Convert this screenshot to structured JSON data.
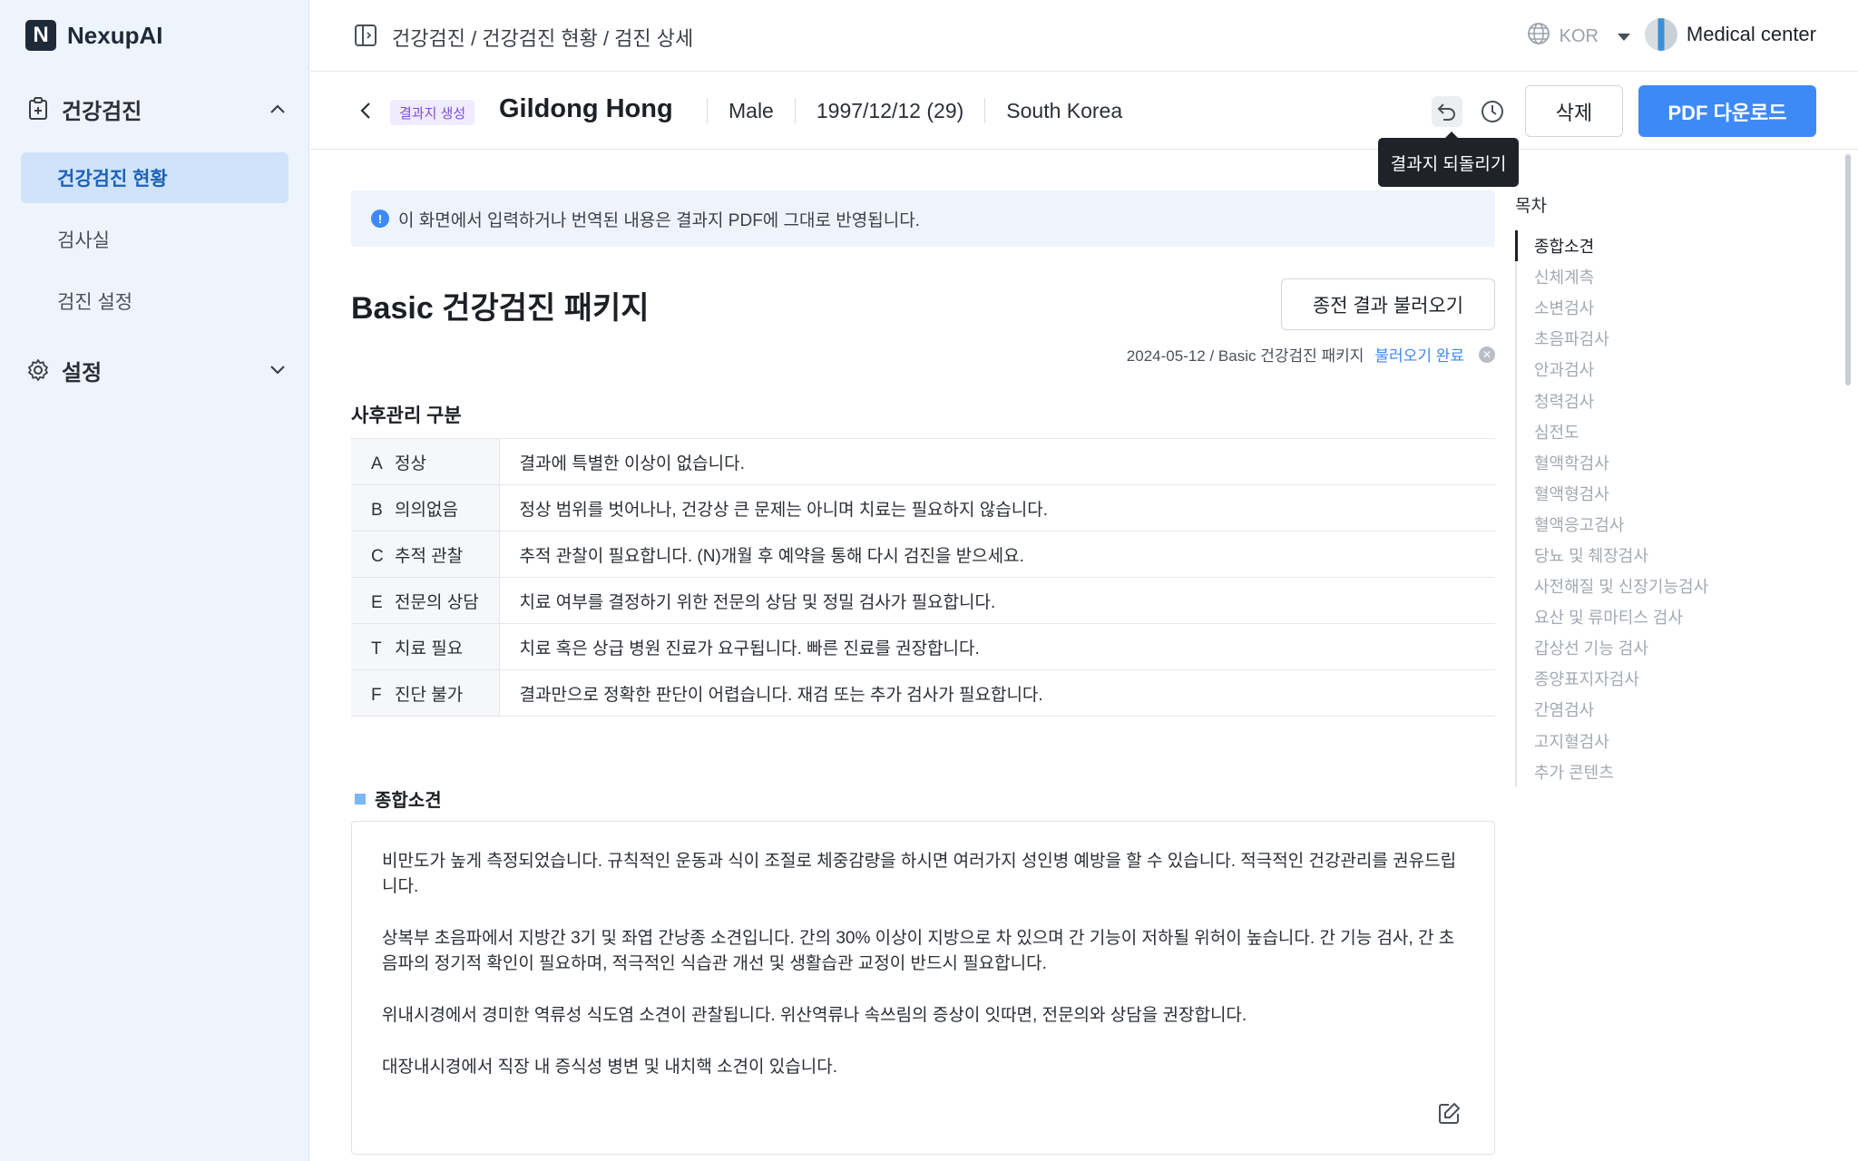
{
  "app": {
    "logo_letter": "N",
    "name": "NexupAI"
  },
  "sidebar": {
    "groups": [
      {
        "label": "건강검진",
        "icon": "clipboard-icon",
        "expanded": true
      },
      {
        "label": "설정",
        "icon": "gear-icon",
        "expanded": false
      }
    ],
    "items": [
      {
        "label": "건강검진 현황",
        "active": true
      },
      {
        "label": "검사실",
        "active": false
      },
      {
        "label": "검진 설정",
        "active": false
      }
    ]
  },
  "header": {
    "breadcrumb": "건강검진 / 건강검진 현황 / 검진 상세",
    "language": "KOR",
    "center_name": "Medical center"
  },
  "patient": {
    "badge": "결과지 생성",
    "name": "Gildong Hong",
    "sex": "Male",
    "birth": "1997/12/12 (29)",
    "country": "South Korea"
  },
  "actions": {
    "delete_label": "삭제",
    "pdf_label": "PDF 다운로드",
    "undo_tooltip": "결과지 되돌리기"
  },
  "notice": "이 화면에서 입력하거나 번역된 내용은 결과지 PDF에 그대로 반영됩니다.",
  "package": {
    "title": "Basic 건강검진 패키지",
    "load_prev_label": "종전 결과 불러오기",
    "loaded_info": "2024-05-12 / Basic 건강검진 패키지",
    "loaded_status": "불러오기 완료"
  },
  "followup": {
    "title": "사후관리 구분",
    "rows": [
      {
        "code": "A",
        "name": "정상",
        "desc": "결과에 특별한 이상이 없습니다."
      },
      {
        "code": "B",
        "name": "의의없음",
        "desc": "정상 범위를 벗어나나, 건강상 큰 문제는 아니며 치료는 필요하지 않습니다."
      },
      {
        "code": "C",
        "name": "추적 관찰",
        "desc": "추적 관찰이 필요합니다. (N)개월 후 예약을 통해 다시 검진을 받으세요."
      },
      {
        "code": "E",
        "name": "전문의 상담",
        "desc": "치료 여부를 결정하기 위한 전문의 상담 및 정밀 검사가 필요합니다."
      },
      {
        "code": "T",
        "name": "치료 필요",
        "desc": "치료 혹은 상급 병원 진료가 요구됩니다. 빠른 진료를 권장합니다."
      },
      {
        "code": "F",
        "name": "진단 불가",
        "desc": "결과만으로 정확한 판단이 어렵습니다. 재검 또는 추가 검사가 필요합니다."
      }
    ]
  },
  "summary": {
    "title": "종합소견",
    "paragraphs": [
      "비만도가 높게 측정되었습니다. 규칙적인 운동과 식이 조절로 체중감량을 하시면 여러가지 성인병 예방을 할 수 있습니다. 적극적인 건강관리를 권유드립니다.",
      "상복부 초음파에서 지방간 3기 및 좌엽 간낭종 소견입니다. 간의 30% 이상이 지방으로 차 있으며 간 기능이 저하될 위허이 높습니다. 간 기능 검사, 간 초음파의 정기적 확인이 필요하며, 적극적인 식습관 개선 및 생활습관 교정이 반드시 필요합니다.",
      "위내시경에서 경미한 역류성 식도염 소견이 관찰됩니다. 위산역류나 속쓰림의 증상이 잇따면, 전문의와 상담을 권장합니다.",
      "대장내시경에서 직장 내 증식성 병변 및 내치핵 소견이 있습니다."
    ]
  },
  "toc": {
    "title": "목차",
    "items": [
      "종합소견",
      "신체계측",
      "소변검사",
      "초음파검사",
      "안과검사",
      "청력검사",
      "심전도",
      "혈액학검사",
      "혈액형검사",
      "혈액응고검사",
      "당뇨 및 췌장검사",
      "사전해질 및 신장기능검사",
      "요산 및 류마티스 검사",
      "갑상선 기능 검사",
      "종양표지자검사",
      "간염검사",
      "고지혈검사",
      "추가 콘텐츠"
    ],
    "active_index": 0
  },
  "colors": {
    "accent": "#3d8af7",
    "sidebar_bg": "#eef4fb",
    "active_nav": "#cfe3fa",
    "badge_text": "#7a4fd8"
  }
}
